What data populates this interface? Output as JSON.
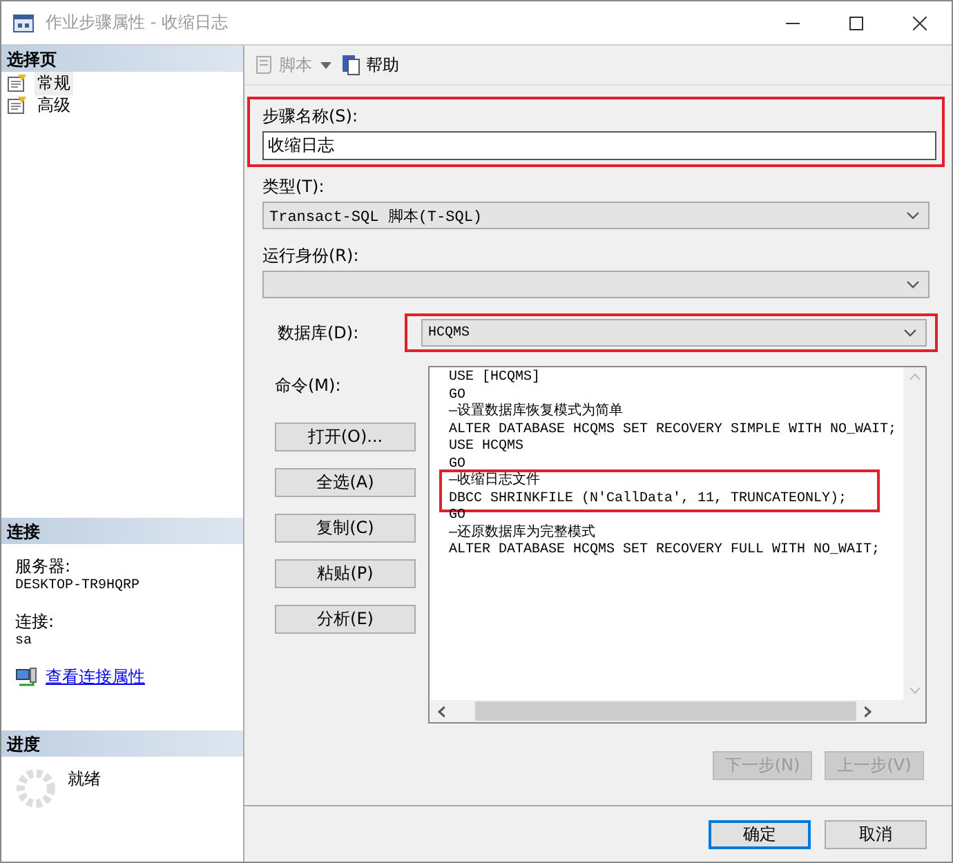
{
  "window": {
    "title": "作业步骤属性 - 收缩日志"
  },
  "sidebar": {
    "select_page": {
      "title": "选择页",
      "items": [
        {
          "label": "常规",
          "selected": true
        },
        {
          "label": "高级",
          "selected": false
        }
      ]
    },
    "connection": {
      "title": "连接",
      "server_label": "服务器:",
      "server": "DESKTOP-TR9HQRP",
      "connection_label": "连接:",
      "user": "sa",
      "link": "查看连接属性"
    },
    "progress": {
      "title": "进度",
      "status": "就绪"
    }
  },
  "toolbar": [
    {
      "label": "脚本",
      "disabled": true,
      "kind": "script"
    },
    {
      "label": "帮助",
      "disabled": false,
      "kind": "help"
    }
  ],
  "step_name": {
    "label": "步骤名称(S):",
    "value": "收缩日志",
    "annotated": true
  },
  "type": {
    "label": "类型(T):",
    "value": "Transact-SQL 脚本(T-SQL)"
  },
  "run_as": {
    "label": "运行身份(R):"
  },
  "database": {
    "label": "数据库(D):",
    "value": "HCQMS",
    "annotated": true
  },
  "command": {
    "label": "命令(M):",
    "buttons": [
      "打开(O)...",
      "全选(A)",
      "复制(C)",
      "粘贴(P)",
      "分析(E)"
    ],
    "lines": [
      {
        "text": "USE [HCQMS]",
        "annotated": false
      },
      {
        "text": "GO",
        "annotated": false
      },
      {
        "text": "—设置数据库恢复模式为简单",
        "annotated": false
      },
      {
        "text": "ALTER DATABASE HCQMS SET RECOVERY SIMPLE WITH NO_WAIT;",
        "annotated": false
      },
      {
        "text": "USE HCQMS",
        "annotated": false
      },
      {
        "text": "GO",
        "annotated": false
      },
      {
        "text": "—收缩日志文件",
        "annotated": true
      },
      {
        "text": "DBCC SHRINKFILE (N'CallData', 11, TRUNCATEONLY);",
        "annotated": true
      },
      {
        "text": "GO",
        "annotated": false
      },
      {
        "text": "—还原数据库为完整模式",
        "annotated": false
      },
      {
        "text": "ALTER DATABASE HCQMS SET RECOVERY FULL WITH NO_WAIT;",
        "annotated": false
      }
    ]
  },
  "nav_buttons": [
    {
      "label": "下一步(N)",
      "disabled": true
    },
    {
      "label": "上一步(V)",
      "disabled": true
    }
  ],
  "dialog_buttons": [
    {
      "label": "确定",
      "default": true
    },
    {
      "label": "取消",
      "default": false
    }
  ]
}
